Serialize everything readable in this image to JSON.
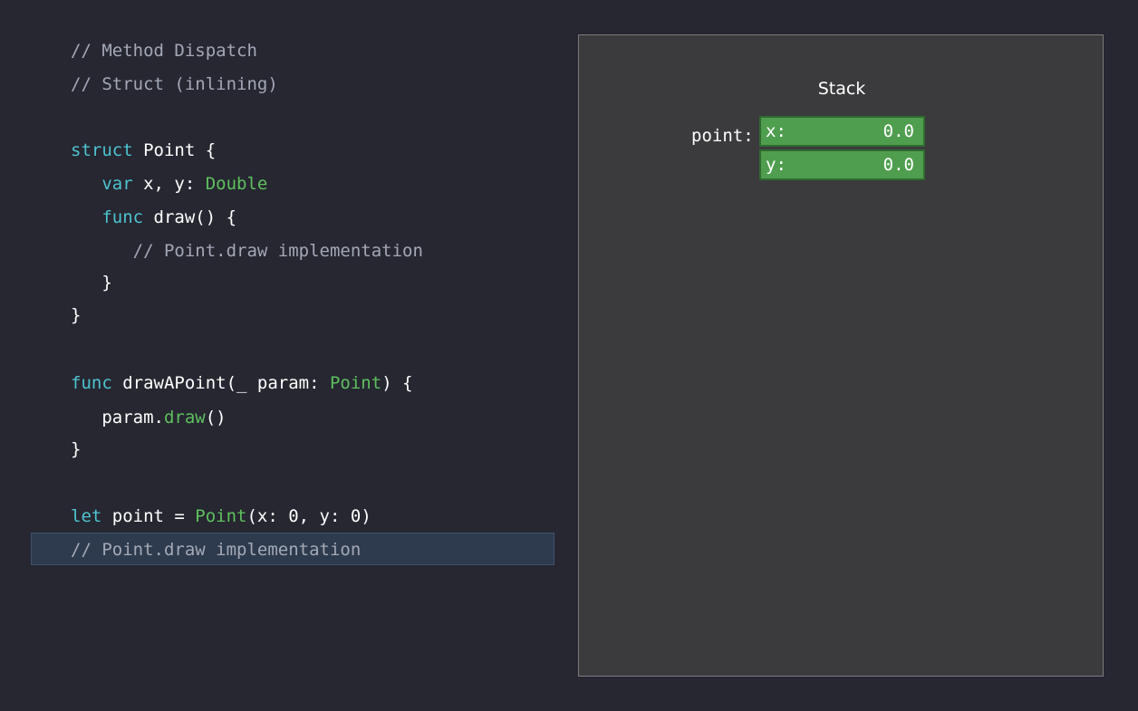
{
  "code": {
    "lines": [
      [
        {
          "t": "// Method Dispatch",
          "k": "comment"
        }
      ],
      [
        {
          "t": "// Struct (inlining)",
          "k": "comment"
        }
      ],
      [],
      [
        {
          "t": "struct",
          "k": "keyword"
        },
        {
          "t": " Point {",
          "k": "plain"
        }
      ],
      [
        {
          "t": "   ",
          "k": "plain"
        },
        {
          "t": "var",
          "k": "keyword"
        },
        {
          "t": " x, y: ",
          "k": "plain"
        },
        {
          "t": "Double",
          "k": "type"
        }
      ],
      [
        {
          "t": "   ",
          "k": "plain"
        },
        {
          "t": "func",
          "k": "keyword"
        },
        {
          "t": " draw() {",
          "k": "plain"
        }
      ],
      [
        {
          "t": "      // Point.draw implementation",
          "k": "comment"
        }
      ],
      [
        {
          "t": "   }",
          "k": "plain"
        }
      ],
      [
        {
          "t": "}",
          "k": "plain"
        }
      ],
      [],
      [
        {
          "t": "func",
          "k": "keyword"
        },
        {
          "t": " drawAPoint(_ param: ",
          "k": "plain"
        },
        {
          "t": "Point",
          "k": "type"
        },
        {
          "t": ") {",
          "k": "plain"
        }
      ],
      [
        {
          "t": "   param.",
          "k": "plain"
        },
        {
          "t": "draw",
          "k": "type"
        },
        {
          "t": "()",
          "k": "plain"
        }
      ],
      [
        {
          "t": "}",
          "k": "plain"
        }
      ],
      [],
      [
        {
          "t": "let",
          "k": "keyword"
        },
        {
          "t": " point = ",
          "k": "plain"
        },
        {
          "t": "Point",
          "k": "type"
        },
        {
          "t": "(x: 0, y: 0)",
          "k": "plain"
        }
      ],
      [
        {
          "t": "// Point.draw implementation",
          "k": "comment"
        }
      ]
    ],
    "highlighted_line_index": 15
  },
  "stack": {
    "title": "Stack",
    "variable_label": "point:",
    "cells": [
      {
        "field": "x:",
        "value": "0.0"
      },
      {
        "field": "y:",
        "value": "0.0"
      }
    ]
  },
  "colors": {
    "background": "#262731",
    "comment": "#a4a8b6",
    "keyword": "#4ec3d0",
    "type": "#5ec05e",
    "plain": "#ffffff",
    "highlight": "#2e3b4e",
    "stack_panel": "#3b3b3d",
    "stack_cell": "#4f9e4f"
  }
}
